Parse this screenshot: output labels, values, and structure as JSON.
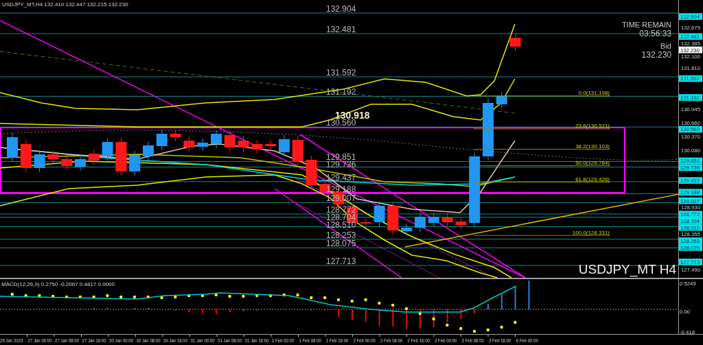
{
  "header": {
    "symbol": "USDJPY_MT,H4",
    "quote": "132.410 132.447 132.215 132.230"
  },
  "info": {
    "time_remain_label": "TIME REMAIN",
    "time_remain": "03:56:33",
    "bid_label": "Bid",
    "bid": "132.230"
  },
  "highlight_price": "130.918",
  "levels": [
    {
      "label": "132.904",
      "tag": "132.904"
    },
    {
      "label": "132.481",
      "tag": "132.481"
    },
    {
      "label": "131.592",
      "tag": "131.592"
    },
    {
      "label": "131.192",
      "tag": "131.192"
    },
    {
      "label": "130.560",
      "tag": "130.560"
    },
    {
      "label": "129.851",
      "tag": "129.851"
    },
    {
      "label": "129.736",
      "tag": "129.736"
    },
    {
      "label": "129.437",
      "tag": "129.437"
    },
    {
      "label": "129.188",
      "tag": "129.188"
    },
    {
      "label": "129.007",
      "tag": "129.007"
    },
    {
      "label": "128.772",
      "tag": "128.772"
    },
    {
      "label": "128.704",
      "tag": "128.704"
    },
    {
      "label": "128.510",
      "tag": "128.510"
    },
    {
      "label": "128.253",
      "tag": "128.253"
    },
    {
      "label": "128.075",
      "tag": "128.075"
    },
    {
      "label": "127.713",
      "tag": "127.713"
    }
  ],
  "fibonacci": [
    "0.0(131.198)",
    "23.6(130.521)",
    "38.2(130.103)",
    "50.0(129.764)",
    "61.8(129.426)",
    "100.0(128.331)"
  ],
  "bid_tag": "132.230",
  "price_ticks": [
    "132.675",
    "132.385",
    "132.100",
    "131.810",
    "130.945",
    "130.660",
    "130.370",
    "130.080",
    "128.930",
    "128.355",
    "127.490"
  ],
  "chart_label": "USDJPY_MT H4",
  "macd": {
    "label": "MACD(12,26,9) 0.2750 -0.2067 0.4817 0.0000",
    "ticks": [
      "0.5245",
      "0.00",
      "-0.418"
    ]
  },
  "time_axis": [
    "26 Jan 2023",
    "27 Jan 00:00",
    "27 Jan 08:00",
    "27 Jan 16:00",
    "30 Jan 00:00",
    "30 Jan 08:00",
    "30 Jan 16:00",
    "31 Jan 00:00",
    "31 Jan 08:00",
    "31 Jan 16:00",
    "1 Feb 00:00",
    "1 Feb 08:00",
    "1 Feb 16:00",
    "2 Feb 00:00",
    "2 Feb 08:00",
    "2 Feb 16:00",
    "3 Feb 00:00",
    "3 Feb 08:00",
    "3 Feb 16:00",
    "6 Feb 00:00"
  ]
}
